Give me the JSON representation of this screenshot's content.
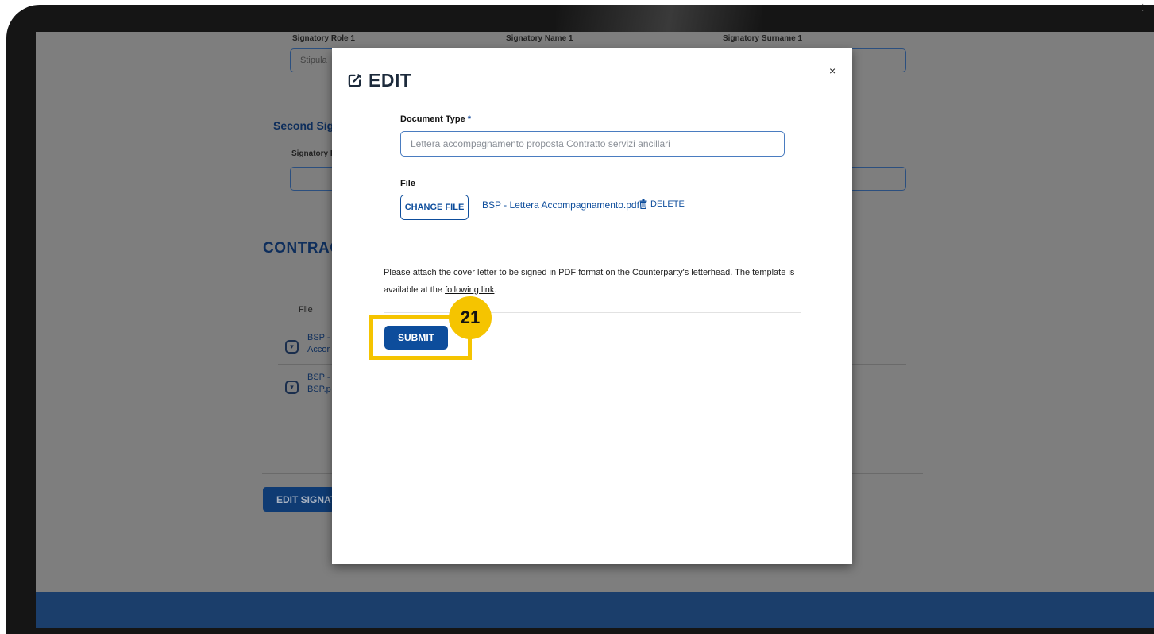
{
  "background": {
    "labels": {
      "signatory_role_1": "Signatory Role 1",
      "signatory_name_1": "Signatory Name 1",
      "signatory_surname_1": "Signatory Surname 1",
      "role_1_value": "Stipula",
      "second_signatory_heading": "Second Sig",
      "signatory_role_2": "Signatory R",
      "contract_heading": "CONTRACT",
      "file_column": "File"
    },
    "rows": [
      {
        "line1": "BSP -",
        "line2": "Accor"
      },
      {
        "line1": "BSP -",
        "line2": "BSP.p"
      }
    ],
    "edit_signatories_button": "EDIT SIGNAT"
  },
  "modal": {
    "title": "EDIT",
    "document_type_label": "Document Type",
    "required_marker": "*",
    "document_type_value": "Lettera accompagnamento proposta Contratto servizi ancillari",
    "file_label": "File",
    "change_file_button": "CHANGE FILE",
    "file_name": "BSP - Lettera Accompagnamento.pdf",
    "delete_label": "DELETE",
    "help_text_prefix": "Please attach the cover letter to be signed in PDF format on the Counterparty's letterhead. The template is available at the ",
    "help_link": "following link",
    "help_text_suffix": ".",
    "submit_button": "SUBMIT",
    "close_symbol": "×"
  },
  "annotation": {
    "step_number": "21",
    "highlight_color": "#f5c400"
  },
  "colors": {
    "primary": "#0d4d9c",
    "overlay": "#7e7e7e",
    "footer": "#1b3e6b"
  }
}
